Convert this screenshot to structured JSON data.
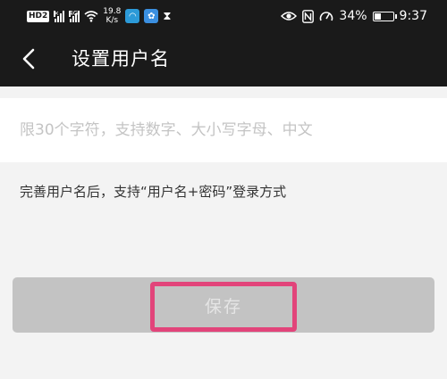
{
  "status_bar": {
    "hd_label": "HD",
    "hd_sub": "2",
    "network_label": "4G",
    "speed_value": "19.8",
    "speed_unit": "K/s",
    "battery_percent": "34%",
    "battery_level": 0.34,
    "time": "9:37"
  },
  "nav": {
    "title": "设置用户名"
  },
  "form": {
    "username_value": "",
    "username_placeholder": "限30个字符，支持数字、大小写字母、中文",
    "hint": "完善用户名后，支持“用户名+密码”登录方式"
  },
  "actions": {
    "save_label": "保存"
  },
  "colors": {
    "header_bg": "#1a1a1a",
    "page_bg": "#f3f3f3",
    "button_disabled_bg": "#c3c3c3",
    "highlight": "#e2447a"
  }
}
